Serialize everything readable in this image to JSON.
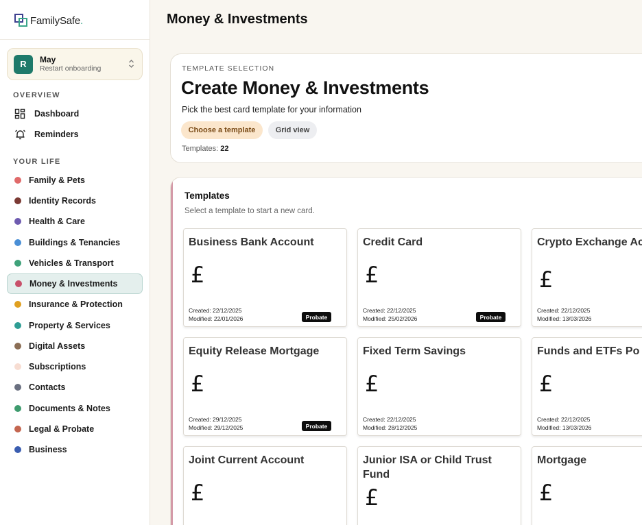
{
  "brand": {
    "name": "FamilySafe",
    "dot": "."
  },
  "account": {
    "initial": "R",
    "name": "May",
    "subtitle": "Restart onboarding"
  },
  "sidebar": {
    "overview_label": "OVERVIEW",
    "overview_items": [
      {
        "label": "Dashboard",
        "icon": "dashboard-icon"
      },
      {
        "label": "Reminders",
        "icon": "bell-icon"
      }
    ],
    "life_label": "YOUR LIFE",
    "life_items": [
      {
        "label": "Family & Pets",
        "color": "#e06a6a"
      },
      {
        "label": "Identity Records",
        "color": "#7b3a34"
      },
      {
        "label": "Health & Care",
        "color": "#6e5bb0"
      },
      {
        "label": "Buildings & Tenancies",
        "color": "#4a8fd6"
      },
      {
        "label": "Vehicles & Transport",
        "color": "#3fa27a"
      },
      {
        "label": "Money & Investments",
        "color": "#c8506a",
        "active": true
      },
      {
        "label": "Insurance & Protection",
        "color": "#e0a020"
      },
      {
        "label": "Property & Services",
        "color": "#2e9d94"
      },
      {
        "label": "Digital Assets",
        "color": "#8b6e55"
      },
      {
        "label": "Subscriptions",
        "color": "#f7ddd2"
      },
      {
        "label": "Contacts",
        "color": "#6a7080"
      },
      {
        "label": "Documents & Notes",
        "color": "#3e9b6e"
      },
      {
        "label": "Legal & Probate",
        "color": "#c46650"
      },
      {
        "label": "Business",
        "color": "#3a5db0"
      }
    ]
  },
  "main": {
    "title": "Money & Investments"
  },
  "hero": {
    "eyebrow": "TEMPLATE SELECTION",
    "title": "Create Money & Investments",
    "subtitle": "Pick the best card template for your information",
    "primary_button": "Choose a template",
    "secondary_button": "Grid view",
    "count_label": "Templates:",
    "count_value": "22"
  },
  "templates": {
    "title": "Templates",
    "subtitle": "Select a template to start a new card.",
    "cards": [
      {
        "title": "Business Bank Account",
        "icon": "£",
        "created": "Created: 22/12/2025",
        "modified": "Modified: 22/01/2026",
        "badge": "Probate"
      },
      {
        "title": "Credit Card",
        "icon": "£",
        "created": "Created: 22/12/2025",
        "modified": "Modified: 25/02/2026",
        "badge": "Probate"
      },
      {
        "title": "Crypto Exchange Account",
        "icon": "£",
        "created": "Created: 22/12/2025",
        "modified": "Modified: 13/03/2026",
        "badge": ""
      },
      {
        "title": "Equity Release Mortgage",
        "icon": "£",
        "created": "Created: 29/12/2025",
        "modified": "Modified: 29/12/2025",
        "badge": "Probate"
      },
      {
        "title": "Fixed Term Savings",
        "icon": "£",
        "created": "Created: 22/12/2025",
        "modified": "Modified: 28/12/2025",
        "badge": ""
      },
      {
        "title": "Funds and ETFs Po",
        "icon": "£",
        "created": "Created: 22/12/2025",
        "modified": "Modified: 13/03/2026",
        "badge": ""
      },
      {
        "title": "Joint Current Account",
        "icon": "£",
        "created": "",
        "modified": "",
        "badge": ""
      },
      {
        "title": "Junior ISA or Child Trust Fund",
        "icon": "£",
        "created": "",
        "modified": "",
        "badge": ""
      },
      {
        "title": "Mortgage",
        "icon": "£",
        "created": "",
        "modified": "",
        "badge": ""
      }
    ]
  }
}
